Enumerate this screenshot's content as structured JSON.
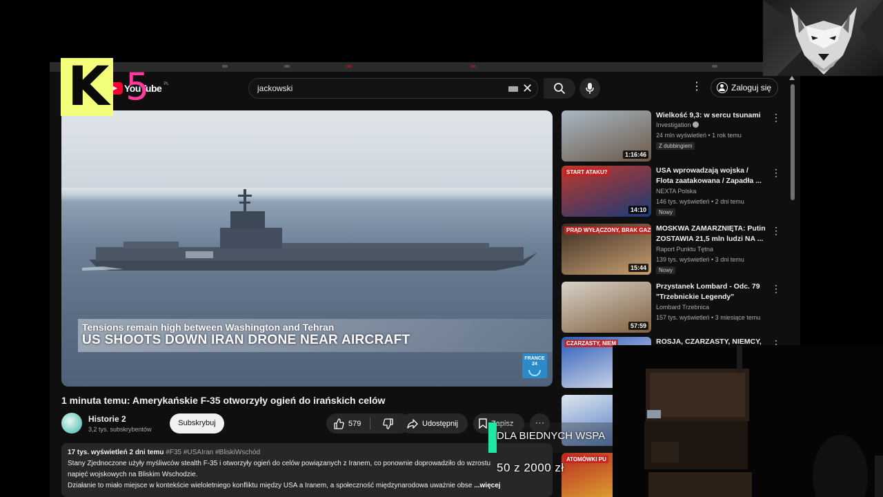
{
  "youtube": {
    "logo_word": "YouTube",
    "logo_region": "PL",
    "search_query": "jackowski",
    "sign_in": "Zaloguj się"
  },
  "video": {
    "lower_third_sub": "Tensions remain high between Washington and Tehran",
    "lower_third_head": "US SHOOTS DOWN IRAN DRONE NEAR AIRCRAFT",
    "network_logo": "FRANCE 24",
    "title": "1 minuta temu: Amerykańskie F-35 otworzyły ogień do irańskich celów",
    "channel": "Historie 2",
    "subscribers": "3,2 tys. subskrybentów",
    "subscribe": "Subskrybuj",
    "likes": "579",
    "share": "Udostępnij",
    "save": "Zapisz"
  },
  "description": {
    "meta": "17 tys. wyświetleń  2 dni temu",
    "tags": "#F35 #USAIran #BliskiWschód",
    "line1": "Stany Zjednoczone użyły myśliwców stealth F-35 i otworzyły ogień do celów powiązanych z Iranem, co ponownie doprowadziło do wzrostu",
    "line2": "napięć wojskowych na Bliskim Wschodzie.",
    "line3": "Działanie to miało miejsce w kontekście wieloletniego konfliktu między USA a Iranem, a społeczność międzynarodowa uważnie obse",
    "more": "...więcej"
  },
  "recommendations": [
    {
      "title": "Wielkość 9,3: w sercu tsunami",
      "channel": "Investigation",
      "verified": true,
      "stats": "24 mln wyświetleń • 1 rok temu",
      "badge": "Z dubbingiem",
      "duration": "1:16:46",
      "colors": [
        "#a8b8c4",
        "#6c5848"
      ]
    },
    {
      "title": "USA wprowadzają wojska / Flota zaatakowana / Zapadła ...",
      "channel": "NEXTA Polska",
      "verified": false,
      "stats": "146 tys. wyświetleń • 2 dni temu",
      "badge": "Nowy",
      "duration": "14:10",
      "thumb_text": "START ATAKU?",
      "colors": [
        "#c03828",
        "#1a3a78"
      ]
    },
    {
      "title": "MOSKWA ZAMARZNIĘTA: Putin ZOSTAWIA 21,5 mln ludzi NA ...",
      "channel": "Raport Punktu Tętna",
      "verified": false,
      "stats": "139 tys. wyświetleń • 3 dni temu",
      "badge": "Nowy",
      "duration": "15:44",
      "thumb_text": "PRĄD WYŁĄCZONY, BRAK GAZU",
      "colors": [
        "#3a2c24",
        "#c8a070"
      ]
    },
    {
      "title": "Przystanek Lombard - Odc. 79 \"Trzebnickie Legendy\"",
      "channel": "Lombard Trzebnica",
      "verified": false,
      "stats": "157 tys. wyświetleń • 3 miesiące temu",
      "badge": "",
      "duration": "57:59",
      "colors": [
        "#d8d2c8",
        "#806040"
      ]
    },
    {
      "title": "ROSJA, CZARZASTY, NIEMCY,",
      "channel": "",
      "verified": false,
      "stats": "",
      "badge": "",
      "duration": "",
      "thumb_text": "CZARZASTY, NIEM",
      "colors": [
        "#2a5cb8",
        "#e8e8f0"
      ]
    },
    {
      "title": "",
      "channel": "",
      "verified": false,
      "stats": "",
      "badge": "",
      "duration": "",
      "colors": [
        "#dde6f0",
        "#3c6ab8"
      ]
    },
    {
      "title": "",
      "channel": "",
      "verified": false,
      "stats": "",
      "badge": "",
      "duration": "",
      "thumb_text": "ATOMÓWKI PU",
      "colors": [
        "#b82c20",
        "#e8c038"
      ]
    }
  ],
  "overlay": {
    "k5_letter": "K",
    "k5_number": "5",
    "goal_label": "DLA BIEDNYCH WSPA",
    "goal_amount": "50 z 2000 zł",
    "goal_progress": 0.025,
    "goal_color": "#1fe8a4"
  }
}
